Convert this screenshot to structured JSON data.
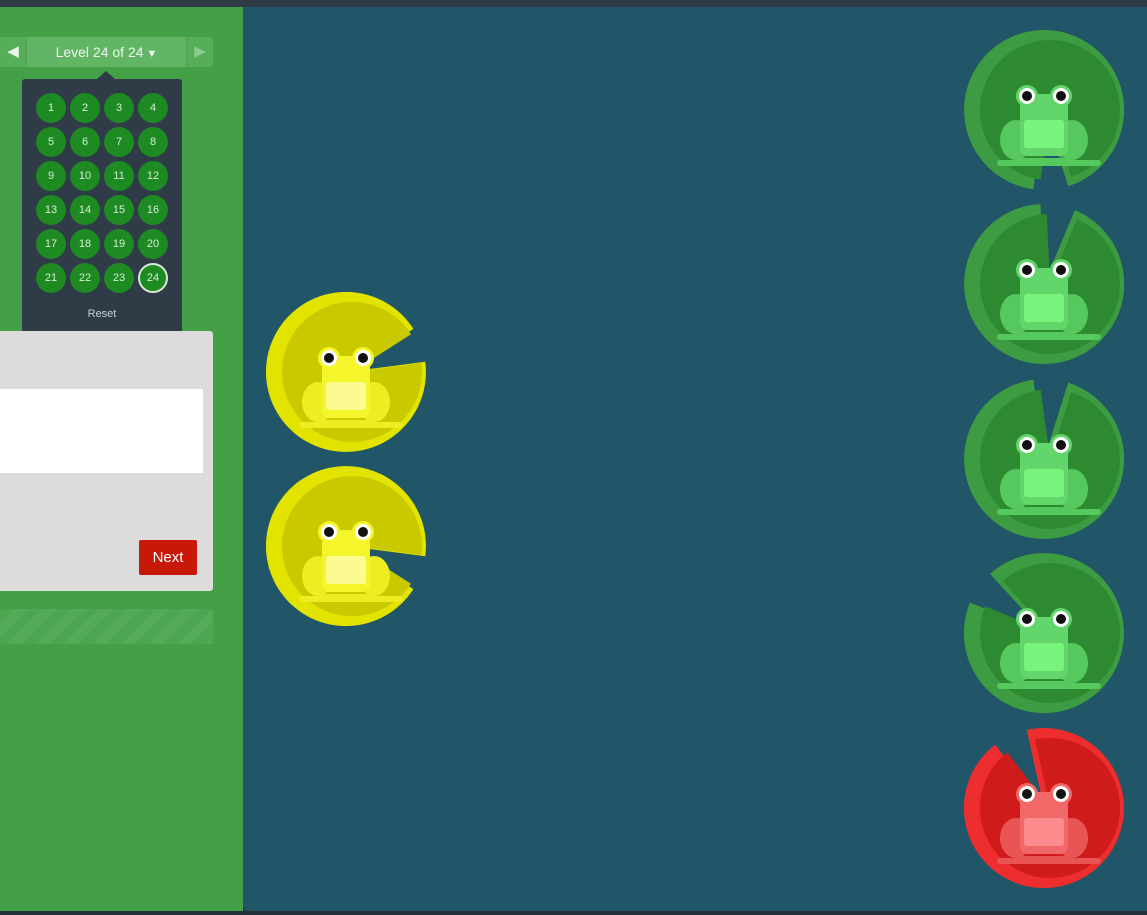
{
  "navigation": {
    "prev_icon": "triangle-left-icon",
    "next_icon": "triangle-right-icon",
    "level_label": "Level 24 of 24",
    "dropdown_icon": "caret-down-icon"
  },
  "level_menu": {
    "levels": [
      "1",
      "2",
      "3",
      "4",
      "5",
      "6",
      "7",
      "8",
      "9",
      "10",
      "11",
      "12",
      "13",
      "14",
      "15",
      "16",
      "17",
      "18",
      "19",
      "20",
      "21",
      "22",
      "23",
      "24"
    ],
    "current_level": "24",
    "reset_label": "Reset"
  },
  "instructions": {
    "editor_value": "",
    "next_label": "Next"
  },
  "pond": {
    "frogs": [
      {
        "name": "yellow-frog-1",
        "color": "yellow",
        "lilypad": "yellow"
      },
      {
        "name": "yellow-frog-2",
        "color": "yellow",
        "lilypad": "yellow"
      }
    ],
    "lilypads": [
      {
        "name": "green-lilypad-1",
        "color": "green",
        "frog": "green"
      },
      {
        "name": "green-lilypad-2",
        "color": "green",
        "frog": "green"
      },
      {
        "name": "green-lilypad-3",
        "color": "green",
        "frog": "green"
      },
      {
        "name": "green-lilypad-4",
        "color": "green",
        "frog": "green"
      },
      {
        "name": "red-lilypad-1",
        "color": "red",
        "frog": "red"
      }
    ]
  },
  "colors": {
    "sidebar_bg": "#43a047",
    "pond_bg": "#205668",
    "level_dot": "#1d8a22",
    "next_button": "#c8180a",
    "green_frog": "#62d56b",
    "yellow_frog": "#f2f230",
    "red_frog": "#f06a6a"
  }
}
